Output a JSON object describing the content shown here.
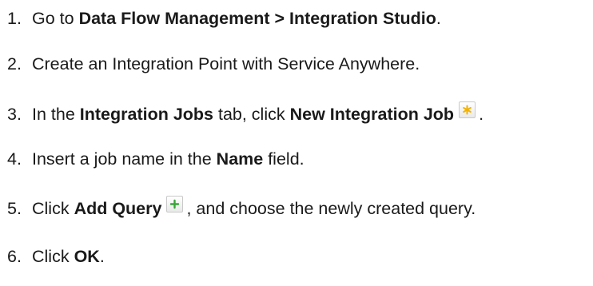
{
  "steps": [
    {
      "num": "1.",
      "t1": "Go to ",
      "b1": "Data Flow Management > Integration Studio",
      "t2": "."
    },
    {
      "num": "2.",
      "t1": "Create an Integration Point with Service Anywhere."
    },
    {
      "num": "3.",
      "t1": "In the ",
      "b1": "Integration Jobs",
      "t2": " tab, click ",
      "b2": "New Integration Job",
      "after": " ."
    },
    {
      "num": "4.",
      "t1": "Insert a job name in the ",
      "b1": "Name",
      "t2": " field."
    },
    {
      "num": "5.",
      "t1": "Click ",
      "b1": "Add Query",
      "after": " , and choose the newly created query."
    },
    {
      "num": "6.",
      "t1": "Click ",
      "b1": "OK",
      "t2": "."
    }
  ],
  "icons": {
    "new_job": "new-job-star-icon",
    "add_query": "add-query-plus-icon",
    "star_color": "#f2b200",
    "plus_color": "#3aa53a"
  }
}
